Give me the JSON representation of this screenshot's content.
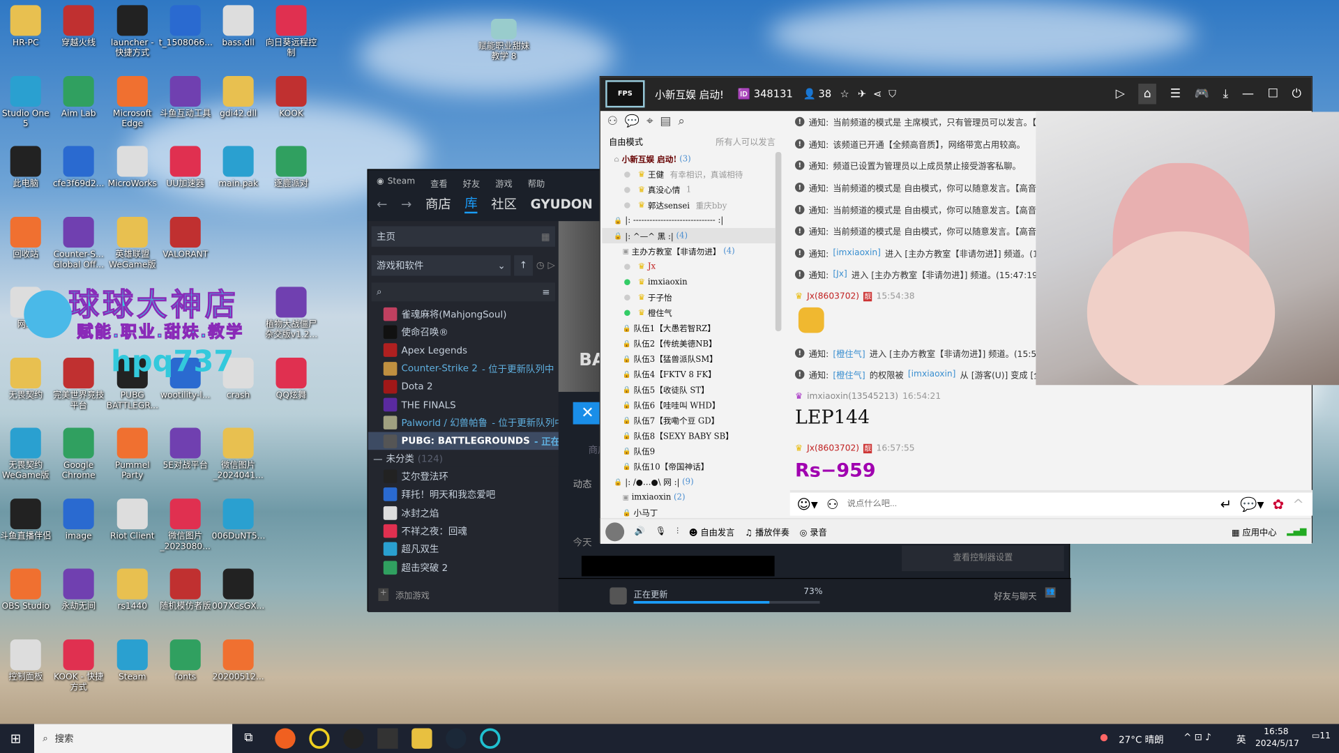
{
  "desktop": {
    "icons": [
      [
        "HR-PC",
        "穿越火线",
        "launcher - 快捷方式",
        "t_1508066...",
        "bass.dll",
        "向日葵远程控制"
      ],
      [
        "Studio One 5",
        "Aim Lab",
        "Microsoft Edge",
        "斗鱼互动工具",
        "gdi42.dll",
        "KOOK"
      ],
      [
        "此电脑",
        "cfe3f69d2...",
        "MicroWorks",
        "UU加速器",
        "main.pak",
        "逐鹿派对"
      ],
      [
        "回收站",
        "Counter-S... Global Off...",
        "英雄联盟 WeGame版",
        "VALORANT",
        "",
        ""
      ],
      [
        "网...",
        "",
        "",
        "",
        "",
        "植物大战僵尸杂交版v1.2..."
      ],
      [
        "无畏契约",
        "完美世界竞技平台",
        "PUBG BATTLEGR...",
        "wootility-l...",
        "crash",
        "QQ炫舞"
      ],
      [
        "无畏契约 WeGame版",
        "Google Chrome",
        "Pummel Party",
        "5E对战平台",
        "微信图片_2024041...",
        ""
      ],
      [
        "斗鱼直播伴侣",
        "image",
        "Riot Client",
        "微信图片_2023080...",
        "006DuNT5...",
        ""
      ],
      [
        "OBS Studio",
        "永劫无间",
        "rs1440",
        "随机模仿者版",
        "007XCsGX...",
        ""
      ],
      [
        "控制面板",
        "KOOK - 快捷方式",
        "Steam",
        "fonts",
        "20200512...",
        ""
      ]
    ],
    "extra_icon": "赋能职业甜妹教学 8",
    "watermark": {
      "line1": "球球大神店",
      "line2": "赋能.职业.甜妹.教学",
      "line3": "hpq737"
    }
  },
  "steam": {
    "menu": [
      "Steam",
      "查看",
      "好友",
      "游戏",
      "帮助"
    ],
    "nav": [
      "商店",
      "库",
      "社区",
      "GYUDON"
    ],
    "home": "主页",
    "filter": "游戏和软件",
    "games": [
      {
        "name": "雀魂麻将(MahjongSoul)",
        "status": "",
        "color": "#c04060"
      },
      {
        "name": "使命召唤®",
        "status": "",
        "color": "#111"
      },
      {
        "name": "Apex Legends",
        "status": "",
        "color": "#b02020"
      },
      {
        "name": "Counter-Strike 2",
        "status": " - 位于更新队列中",
        "color": "#c09040"
      },
      {
        "name": "Dota 2",
        "status": "",
        "color": "#a01818"
      },
      {
        "name": "THE FINALS",
        "status": "",
        "color": "#5a2aa0"
      },
      {
        "name": "Palworld / 幻兽帕鲁",
        "status": " - 位于更新队列中",
        "color": "#a0a080"
      },
      {
        "name": "PUBG: BATTLEGROUNDS",
        "status": " - 正在启动",
        "color": "#555",
        "selected": true
      }
    ],
    "uncategorized": {
      "label": "未分类",
      "count": "(124)"
    },
    "games2": [
      "艾尔登法环",
      "拜托！明天和我恋爱吧",
      "冰封之焰",
      "不祥之夜：回魂",
      "超凡双生",
      "超击突破 2"
    ],
    "add_game": "添加游戏",
    "main": {
      "activity": "动态",
      "today": "今天",
      "store": "商店",
      "controller": "查看控制器设置",
      "banner": "BAT"
    },
    "download": {
      "label": "正在更新",
      "percent": 73
    },
    "friends": "好友与聊天"
  },
  "chat": {
    "room_name": "小新互娱 启动!",
    "room_id": "348131",
    "online": "38",
    "logo": "XIAOXIN FPS",
    "mode": "自由模式",
    "mode_desc": "所有人可以发言",
    "tree": [
      {
        "t": "小新互娱  启动!",
        "c": "(3)",
        "lv": 0,
        "bold": true
      },
      {
        "t": "王健",
        "extra": "有幸相识，真诚相待",
        "lv": 2
      },
      {
        "t": "真没心情",
        "extra": "1",
        "lv": 2
      },
      {
        "t": "郭达sensei",
        "extra": "重庆bby",
        "lv": 2
      },
      {
        "t": "|:  ------------------------------  :|",
        "lv": 0
      },
      {
        "t": "|:       ^—^      黑      :|",
        "c": "(4)",
        "lv": 0,
        "hl": true
      },
      {
        "t": "主办方教室【非请勿进】",
        "c": "(4)",
        "lv": 1
      },
      {
        "t": "Jx",
        "lv": 2,
        "red": true
      },
      {
        "t": "imxiaoxin",
        "lv": 2,
        "on": true
      },
      {
        "t": "于子怡",
        "lv": 2
      },
      {
        "t": "橙住气",
        "lv": 2,
        "on": true
      },
      {
        "t": "队伍1【大愚若智RZ】",
        "lv": 1
      },
      {
        "t": "队伍2【传统美德NB】",
        "lv": 1
      },
      {
        "t": "队伍3【猛兽派队SM】",
        "lv": 1
      },
      {
        "t": "队伍4【FKTV 8  FK】",
        "lv": 1
      },
      {
        "t": "队伍5【收徒队  ST】",
        "lv": 1
      },
      {
        "t": "队伍6【哇哇叫 WHD】",
        "lv": 1
      },
      {
        "t": "队伍7【我嘞个豆 GD】",
        "lv": 1
      },
      {
        "t": "队伍8【SEXY BABY SB】",
        "lv": 1
      },
      {
        "t": "队伍9",
        "lv": 1
      },
      {
        "t": "队伍10【帝国神话】",
        "lv": 1
      },
      {
        "t": "|:     /●…●\\   网     :|",
        "c": "(9)",
        "lv": 0
      },
      {
        "t": "imxiaoxin",
        "c": "(2)",
        "lv": 1
      },
      {
        "t": "小马丁",
        "lv": 1
      }
    ],
    "notices": [
      "当前频道的模式是 主席模式，只有管理员可以发言。【",
      "该频道已开通【全频高音质】，网络带宽占用较高。",
      "频道已设置为管理员以上成员禁止接受游客私聊。",
      "当前频道的模式是 自由模式，你可以随意发言。【高音",
      "当前频道的模式是 自由模式，你可以随意发言。【高音",
      "当前频道的模式是 自由模式，你可以随意发言。【高音"
    ],
    "notice_label": "通知:",
    "join1": {
      "user": "[imxiaoxin]",
      "text": " 进入 [主办方教室【非请勿进】] 频道。(15:47:19)"
    },
    "join2": {
      "user": "[Jx]",
      "text": " 进入 [主办方教室【非请勿进】] 频道。(15:47:19)"
    },
    "msg1": {
      "user": "Jx(8603702)",
      "time": "15:54:38"
    },
    "join3": {
      "user": "[橙住气]",
      "text": " 进入 [主办方教室【非请勿进】] 频道。(15:56"
    },
    "perm": {
      "user": "[橙住气]",
      "mid": " 的权限被 ",
      "admin": "[imxiaoxin]",
      "text": " 从 [游客(U)] 变成 [全频"
    },
    "msg2": {
      "user": "imxiaoxin(13545213)",
      "time": "16:54:21",
      "text": "LEP144"
    },
    "msg3": {
      "user": "Jx(8603702)",
      "time": "16:57:55",
      "text": "Rs−959"
    },
    "input_placeholder": "说点什么吧...",
    "bottom": {
      "free": "自由发言",
      "music": "播放伴奏",
      "record": "录音",
      "apps": "应用中心"
    }
  },
  "taskbar": {
    "search": "搜索",
    "weather": "27°C 晴朗",
    "ime": "英",
    "time": "16:58",
    "date": "2024/5/17",
    "notif": "11"
  }
}
